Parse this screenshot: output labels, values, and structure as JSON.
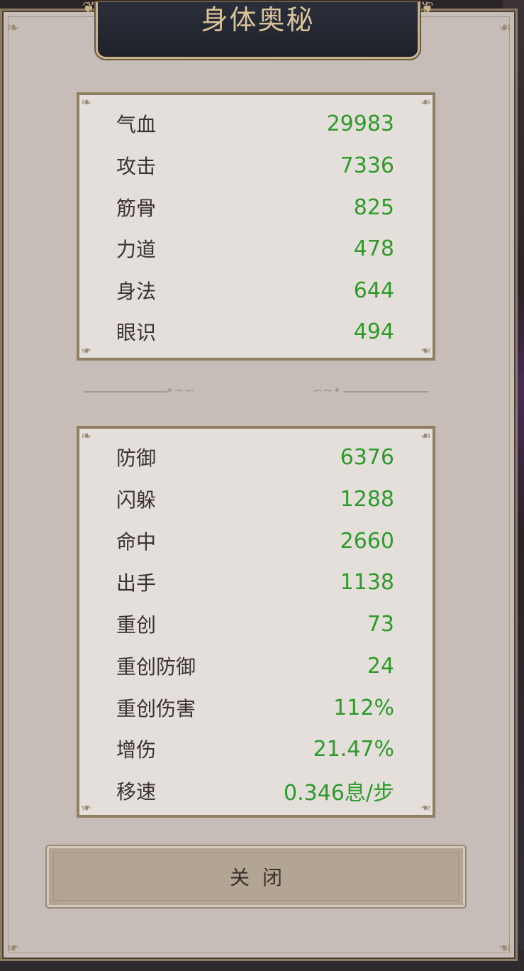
{
  "title": "身体奥秘",
  "primary_stats": [
    {
      "label": "气血",
      "value": "29983"
    },
    {
      "label": "攻击",
      "value": "7336"
    },
    {
      "label": "筋骨",
      "value": "825"
    },
    {
      "label": "力道",
      "value": "478"
    },
    {
      "label": "身法",
      "value": "644"
    },
    {
      "label": "眼识",
      "value": "494"
    }
  ],
  "secondary_stats": [
    {
      "label": "防御",
      "value": "6376"
    },
    {
      "label": "闪躲",
      "value": "1288"
    },
    {
      "label": "命中",
      "value": "2660"
    },
    {
      "label": "出手",
      "value": "1138"
    },
    {
      "label": "重创",
      "value": "73"
    },
    {
      "label": "重创防御",
      "value": "24"
    },
    {
      "label": "重创伤害",
      "value": "112%"
    },
    {
      "label": "增伤",
      "value": "21.47%"
    },
    {
      "label": "移速",
      "value": "0.346息/步"
    }
  ],
  "close_button": {
    "label": "关闭"
  },
  "colors": {
    "panel": "#c6bdb8",
    "stat_box": "#e4dfdb",
    "value_green": "#2e9a2a",
    "title_plate": "#22252e",
    "title_text": "#d8c39a",
    "border_gold": "#8f7f62"
  }
}
